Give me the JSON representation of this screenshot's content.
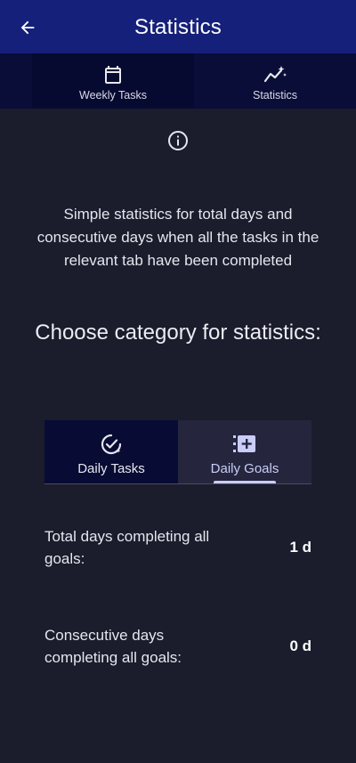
{
  "appbar": {
    "title": "Statistics"
  },
  "tabs": [
    {
      "label": "Weekly Tasks",
      "icon": "calendar-icon"
    },
    {
      "label": "Statistics",
      "icon": "trending-chart-icon",
      "selected": true
    }
  ],
  "info": {
    "description": "Simple statistics for total days and consecutive days when all the tasks in the relevant tab have been completed"
  },
  "category": {
    "heading": "Choose category for statistics:",
    "options": [
      {
        "label": "Daily Tasks",
        "icon": "check-badge-icon"
      },
      {
        "label": "Daily Goals",
        "icon": "add-list-icon",
        "selected": true
      }
    ]
  },
  "stats": [
    {
      "label": "Total days completing all goals:",
      "value": "1 d"
    },
    {
      "label": "Consecutive days completing all goals:",
      "value": "0 d"
    }
  ],
  "colors": {
    "background": "#1b1c2c",
    "appbar": "#15207a",
    "tabbar": "#0a0d38",
    "accent": "#c9cdf7"
  }
}
